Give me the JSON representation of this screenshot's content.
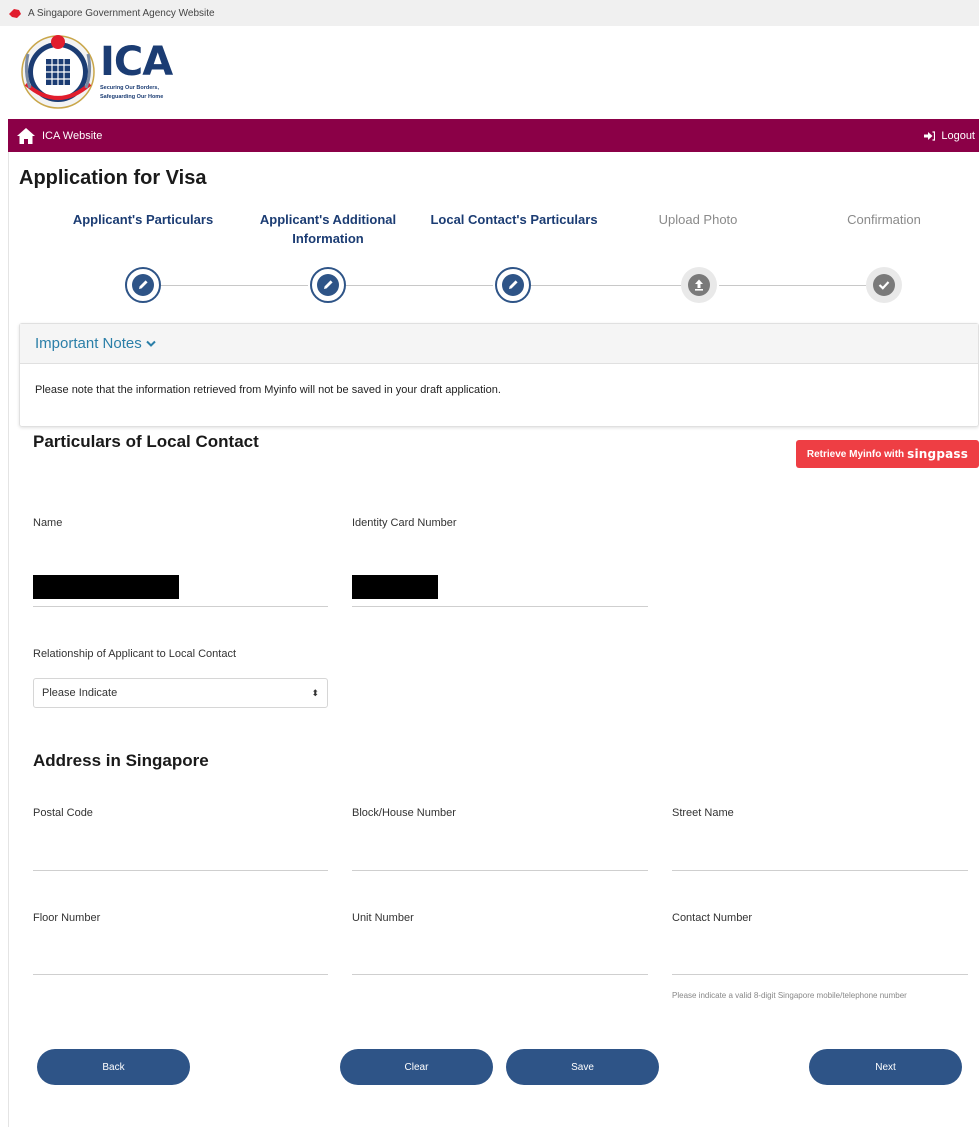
{
  "gov_bar": {
    "text": "A Singapore Government Agency Website",
    "icon": "lion-head-icon"
  },
  "logo": {
    "name": "ICA",
    "tagline_1": "Securing Our Borders,",
    "tagline_2": "Safeguarding Our Home"
  },
  "nav": {
    "home_label": "ICA Website",
    "logout_label": "Logout",
    "bar_color": "#8b0047"
  },
  "page": {
    "title": "Application for Visa"
  },
  "steps": [
    {
      "label_1": "Applicant's Particulars",
      "label_2": "",
      "status": "done",
      "icon": "edit-badge-icon"
    },
    {
      "label_1": "Applicant's Additional",
      "label_2": "Information",
      "status": "done",
      "icon": "edit-badge-icon"
    },
    {
      "label_1": "Local Contact's Particulars",
      "label_2": "",
      "status": "done",
      "icon": "edit-badge-icon"
    },
    {
      "label_1": "Upload Photo",
      "label_2": "",
      "status": "pending",
      "icon": "upload-badge-icon"
    },
    {
      "label_1": "Confirmation",
      "label_2": "",
      "status": "pending",
      "icon": "check-badge-icon"
    }
  ],
  "notes": {
    "heading": "Important Notes",
    "body": "Please note that the information retrieved from Myinfo will not be saved in your draft application."
  },
  "singpass_button": {
    "label": "Retrieve Myinfo with",
    "brand": "singpass",
    "color": "#ee3e44"
  },
  "local_contact": {
    "title": "Particulars of Local Contact",
    "name_label": "Name",
    "id_label": "Identity Card Number",
    "relationship_label": "Relationship of Applicant to Local Contact",
    "relationship_value": "Please Indicate"
  },
  "address": {
    "title": "Address in Singapore",
    "postal_code_label": "Postal Code",
    "block_label": "Block/House Number",
    "street_label": "Street Name",
    "floor_label": "Floor Number",
    "unit_label": "Unit Number",
    "contact_label": "Contact Number",
    "contact_hint": "Please indicate a valid 8-digit Singapore mobile/telephone number"
  },
  "actions": {
    "back": "Back",
    "clear": "Clear",
    "save": "Save",
    "next": "Next",
    "button_color": "#2e5487"
  }
}
